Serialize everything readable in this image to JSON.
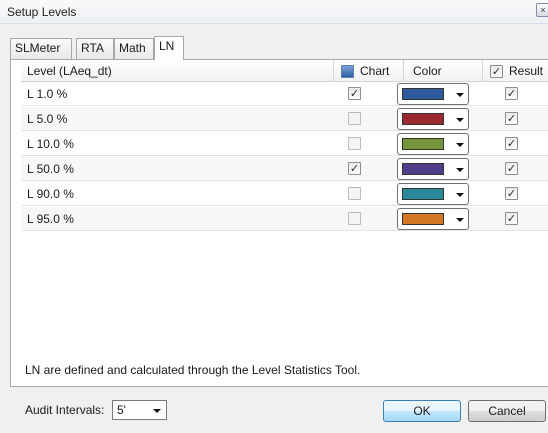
{
  "window": {
    "title": "Setup Levels",
    "close_glyph": "×"
  },
  "tabs": [
    {
      "label": "SLMeter",
      "active": false
    },
    {
      "label": "RTA",
      "active": false
    },
    {
      "label": "Math",
      "active": false
    },
    {
      "label": "LN",
      "active": true
    }
  ],
  "table": {
    "headers": {
      "level": "Level (LAeq_dt)",
      "chart": "Chart",
      "color": "Color",
      "result": "Result"
    },
    "rows": [
      {
        "level": "L 1.0 %",
        "chart": true,
        "color": "#2d5b99",
        "result": true
      },
      {
        "level": "L 5.0 %",
        "chart": false,
        "color": "#9b2a2e",
        "result": true
      },
      {
        "level": "L 10.0 %",
        "chart": false,
        "color": "#74953a",
        "result": true
      },
      {
        "level": "L 50.0 %",
        "chart": true,
        "color": "#4f3d8a",
        "result": true
      },
      {
        "level": "L 90.0 %",
        "chart": false,
        "color": "#29899a",
        "result": true
      },
      {
        "level": "L 95.0 %",
        "chart": false,
        "color": "#d47727",
        "result": true
      }
    ]
  },
  "info_text": "LN are defined and calculated through the Level Statistics Tool.",
  "audit": {
    "label": "Audit Intervals:",
    "value": "5'"
  },
  "buttons": {
    "ok": "OK",
    "cancel": "Cancel"
  },
  "icons": {
    "checkmark": "✓",
    "close": "close-icon",
    "dropdown": "chevron-down-icon",
    "chart_header": "chart-icon"
  }
}
